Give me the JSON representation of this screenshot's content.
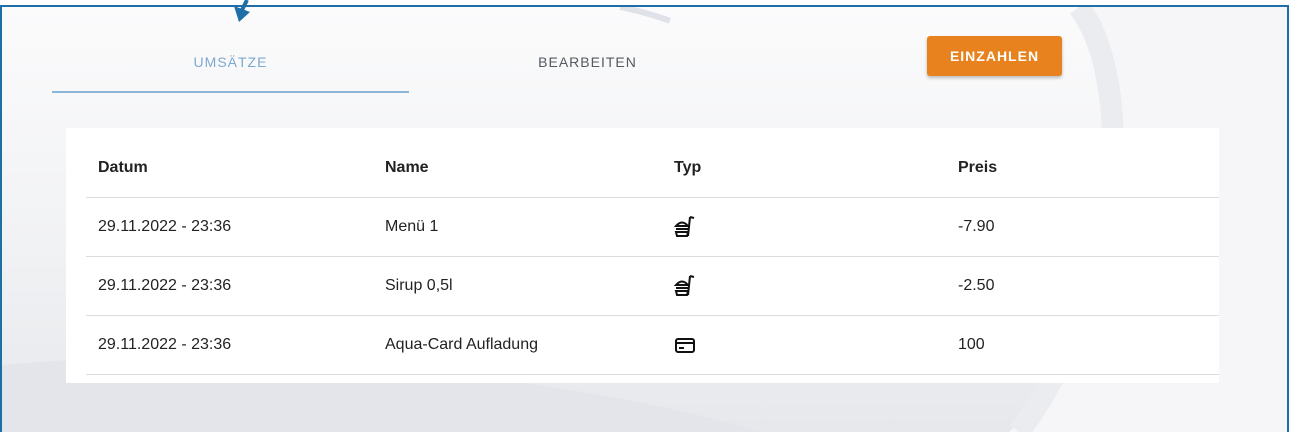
{
  "tabs": [
    {
      "label": "UMSÄTZE",
      "active": true
    },
    {
      "label": "BEARBEITEN",
      "active": false
    }
  ],
  "actions": {
    "deposit_label": "EINZAHLEN"
  },
  "colors": {
    "frame": "#1e6fa8",
    "accent": "#e8821e",
    "active_tab": "#7fa9cf"
  },
  "table": {
    "headers": [
      "Datum",
      "Name",
      "Typ",
      "Preis"
    ],
    "rows": [
      {
        "date": "29.11.2022 - 23:36",
        "name": "Menü 1",
        "type_icon": "food-icon",
        "price": "-7.90"
      },
      {
        "date": "29.11.2022 - 23:36",
        "name": "Sirup 0,5l",
        "type_icon": "food-icon",
        "price": "-2.50"
      },
      {
        "date": "29.11.2022 - 23:36",
        "name": "Aqua-Card Aufladung",
        "type_icon": "credit-card-icon",
        "price": "100"
      }
    ]
  }
}
